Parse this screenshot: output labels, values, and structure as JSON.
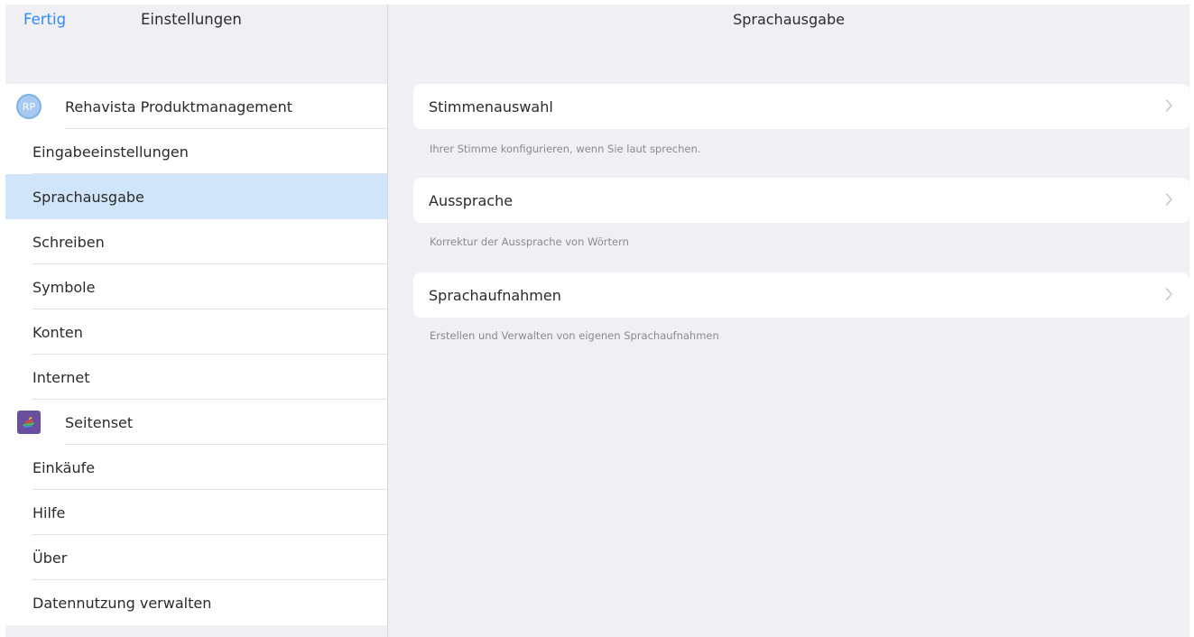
{
  "nav": {
    "done": "Fertig",
    "left_title": "Einstellungen",
    "right_title": "Sprachausgabe"
  },
  "profile": {
    "initials": "RP",
    "name": "Rehavista Produktmanagement"
  },
  "menu": [
    {
      "label": "Eingabeeinstellungen"
    },
    {
      "label": "Sprachausgabe"
    },
    {
      "label": "Schreiben"
    },
    {
      "label": "Symbole"
    },
    {
      "label": "Konten"
    },
    {
      "label": "Internet"
    },
    {
      "label": "Seitenset"
    },
    {
      "label": "Einkäufe"
    },
    {
      "label": "Hilfe"
    },
    {
      "label": "Über"
    },
    {
      "label": "Datennutzung verwalten"
    }
  ],
  "selected_item": "Sprachausgabe",
  "settings": [
    {
      "label": "Stimmenauswahl",
      "description": "Ihrer Stimme konfigurieren, wenn Sie laut sprechen."
    },
    {
      "label": "Aussprache",
      "description": "Korrektur der Aussprache von Wörtern"
    },
    {
      "label": "Sprachaufnahmen",
      "description": "Erstellen und Verwalten von eigenen Sprachaufnahmen"
    }
  ],
  "colors": {
    "accent": "#2f8bf3",
    "selected_background": "#d0e5fa",
    "pane_background": "#efeff4",
    "pageset_icon": "#6a4fa0"
  },
  "icons": {
    "profile": "avatar-initials",
    "pageset": "pageset-icon",
    "row_disclosure": "chevron-right-icon"
  }
}
